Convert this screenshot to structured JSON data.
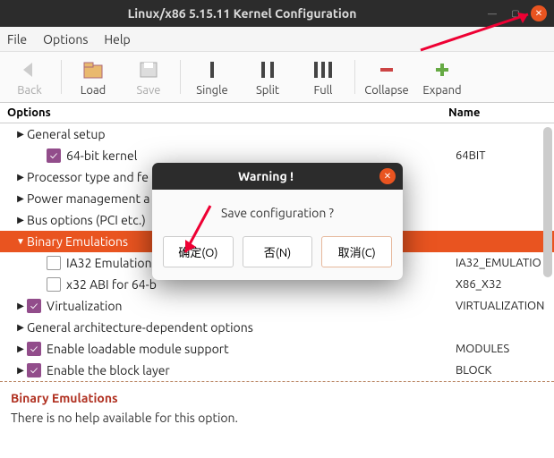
{
  "titlebar": {
    "title": "Linux/x86 5.15.11 Kernel Configuration"
  },
  "menubar": {
    "file": "File",
    "options": "Options",
    "help": "Help"
  },
  "toolbar": {
    "back": "Back",
    "load": "Load",
    "save": "Save",
    "single": "Single",
    "split": "Split",
    "full": "Full",
    "collapse": "Collapse",
    "expand": "Expand"
  },
  "columns": {
    "options": "Options",
    "name": "Name"
  },
  "tree": [
    {
      "indent": 0,
      "arrow": "▶",
      "label": "General setup",
      "name": ""
    },
    {
      "indent": 1,
      "checked": true,
      "label": "64-bit kernel",
      "name": "64BIT"
    },
    {
      "indent": 0,
      "arrow": "▶",
      "label": "Processor type and fe",
      "name": ""
    },
    {
      "indent": 0,
      "arrow": "▶",
      "label": "Power management a",
      "name": ""
    },
    {
      "indent": 0,
      "arrow": "▶",
      "label": "Bus options (PCI etc.)",
      "name": ""
    },
    {
      "indent": 0,
      "arrow": "▼",
      "label": "Binary Emulations",
      "name": "",
      "selected": true
    },
    {
      "indent": 1,
      "checked": false,
      "label": "IA32 Emulation",
      "name": "IA32_EMULATIO"
    },
    {
      "indent": 1,
      "checked": false,
      "label": "x32 ABI for 64-b",
      "name": "X86_X32"
    },
    {
      "indent": 0,
      "arrow": "▶",
      "checked": true,
      "label": "Virtualization",
      "name": "VIRTUALIZATION"
    },
    {
      "indent": 0,
      "arrow": "▶",
      "label": "General architecture-dependent options",
      "name": ""
    },
    {
      "indent": 0,
      "arrow": "▶",
      "checked": true,
      "label": "Enable loadable module support",
      "name": "MODULES"
    },
    {
      "indent": 0,
      "arrow": "▶",
      "checked": true,
      "label": "Enable the block layer",
      "name": "BLOCK"
    }
  ],
  "help": {
    "title": "Binary Emulations",
    "body": "There is no help available for this option."
  },
  "dialog": {
    "title": "Warning !",
    "message": "Save configuration ?",
    "ok": "确定(O)",
    "no": "否(N)",
    "cancel": "取消(C)"
  }
}
